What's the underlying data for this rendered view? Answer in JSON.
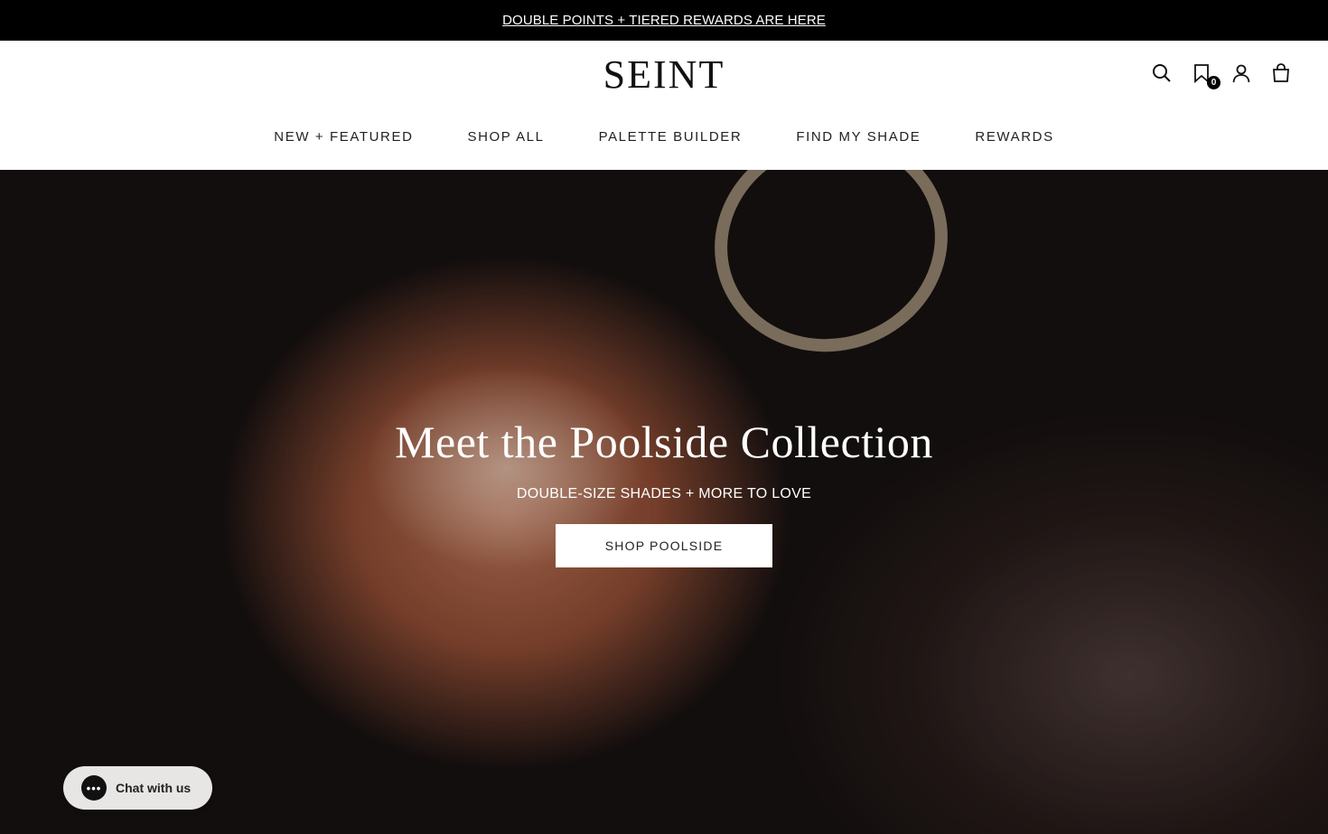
{
  "announcement": {
    "text": "DOUBLE POINTS + TIERED REWARDS ARE HERE"
  },
  "header": {
    "logo": "SEINT",
    "icons": {
      "search": "search-icon",
      "wishlist": "bookmark-icon",
      "wishlist_count": "0",
      "account": "user-icon",
      "cart": "bag-icon"
    }
  },
  "nav": {
    "items": [
      {
        "label": "NEW + FEATURED"
      },
      {
        "label": "SHOP ALL"
      },
      {
        "label": "PALETTE BUILDER"
      },
      {
        "label": "FIND MY SHADE"
      },
      {
        "label": "REWARDS"
      }
    ]
  },
  "hero": {
    "title": "Meet the Poolside Collection",
    "subtitle": "DOUBLE-SIZE SHADES + MORE TO LOVE",
    "cta": "SHOP POOLSIDE"
  },
  "chat": {
    "icon": "chat-dots-icon",
    "label": "Chat with us",
    "dots": "•••"
  },
  "colors": {
    "announcement_bg": "#000000",
    "header_bg": "#ffffff",
    "button_bg": "#ffffff",
    "chat_bg": "#e8e6e4"
  }
}
